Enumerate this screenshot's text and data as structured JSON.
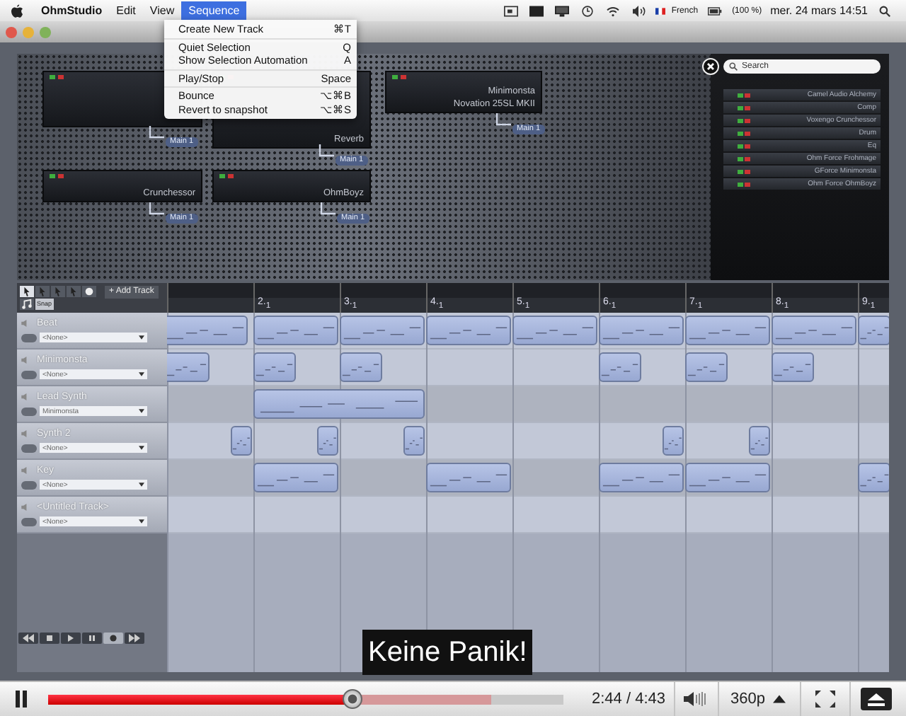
{
  "menubar": {
    "menus": [
      {
        "label": "OhmStudio",
        "selected": false
      },
      {
        "label": "Edit",
        "selected": false
      },
      {
        "label": "View",
        "selected": false
      },
      {
        "label": "Sequence",
        "selected": true
      }
    ],
    "status": {
      "language": "French",
      "battery": "(100 %)",
      "clock": "mer. 24 mars  14:51"
    }
  },
  "sequence_menu": {
    "groups": [
      {
        "items": [
          {
            "label": "Create New Track",
            "shortcut": "⌘T"
          }
        ]
      },
      {
        "items": [
          {
            "label": "Quiet Selection",
            "shortcut": "Q"
          },
          {
            "label": "Show Selection Automation",
            "shortcut": "A"
          }
        ]
      },
      {
        "items": [
          {
            "label": "Play/Stop",
            "shortcut": "Space"
          }
        ]
      },
      {
        "items": [
          {
            "label": "Bounce",
            "shortcut": "⌥⌘B"
          },
          {
            "label": "Revert to snapshot",
            "shortcut": "⌥⌘S"
          }
        ]
      }
    ]
  },
  "rack": {
    "nodes": [
      {
        "output": "Main 1"
      },
      {
        "lines": [
          "Reverb"
        ],
        "output": "Main 1"
      },
      {
        "lines": [
          "Minimonsta",
          "Novation 25SL MKII"
        ],
        "output": "Main 1"
      },
      {
        "lines": [
          "Crunchessor"
        ],
        "output": "Main 1"
      },
      {
        "lines": [
          "OhmBoyz"
        ],
        "output": "Main 1"
      }
    ]
  },
  "plugin_browser": {
    "search": {
      "placeholder": "Search"
    },
    "plugins": [
      "Camel Audio Alchemy",
      "Comp",
      "Voxengo Crunchessor",
      "Drum",
      "Eq",
      "Ohm Force Frohmage",
      "GForce Minimonsta",
      "Ohm Force OhmBoyz"
    ]
  },
  "sequencer": {
    "add_track": "+ Add Track",
    "snap": "Snap",
    "ruler": [
      "2.$_{1}$",
      "3.$_{1}$",
      "4.$_{1}$",
      "5.$_{1}$",
      "6.$_{1}$",
      "7.$_{1}$",
      "8.$_{1}$",
      "9.$_{1}$"
    ],
    "tracks": [
      {
        "name": "Beat",
        "instrument": "<None>"
      },
      {
        "name": "Minimonsta",
        "instrument": "<None>"
      },
      {
        "name": "Lead Synth",
        "instrument": "Minimonsta"
      },
      {
        "name": "Synth 2",
        "instrument": "<None>"
      },
      {
        "name": "Key",
        "instrument": "<None>"
      },
      {
        "name": "<Untitled Track>",
        "instrument": "<None>"
      }
    ]
  },
  "subtitle": "Keine Panik!",
  "player": {
    "playing": true,
    "progress": {
      "level": 0.59
    },
    "buffered": {
      "level": 0.86
    },
    "time": "2:44 / 4:43",
    "quality": "360p"
  }
}
